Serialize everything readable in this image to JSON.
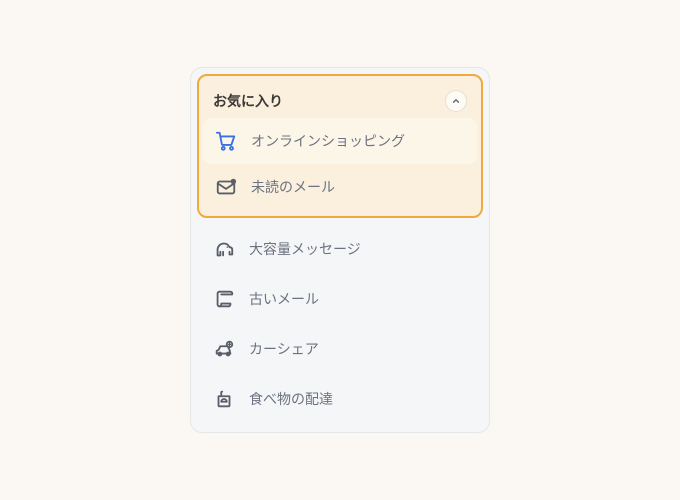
{
  "favorites": {
    "title": "お気に入り",
    "items": [
      {
        "label": "オンラインショッピング",
        "icon": "cart-icon"
      },
      {
        "label": "未読のメール",
        "icon": "mail-unread-icon"
      }
    ]
  },
  "other_items": [
    {
      "label": "大容量メッセージ",
      "icon": "elephant-icon"
    },
    {
      "label": "古いメール",
      "icon": "scroll-icon"
    },
    {
      "label": "カーシェア",
      "icon": "car-coin-icon"
    },
    {
      "label": "食べ物の配達",
      "icon": "food-delivery-icon"
    }
  ],
  "colors": {
    "accent_border": "#F2A93B",
    "accent_bg": "#FAF0DD",
    "icon_gray": "#595E68",
    "icon_blue": "#3B6FE0"
  }
}
